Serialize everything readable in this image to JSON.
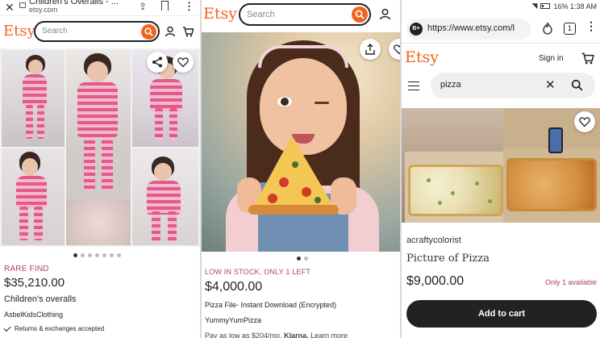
{
  "panel1": {
    "tab_title": "Children's Overalls - ...",
    "tab_url": "etsy.com",
    "logo": "Etsy",
    "search_placeholder": "Search",
    "badge": "RARE FIND",
    "price": "$35,210.00",
    "title": "Children's overalls",
    "shop": "AsbelKidsClothing",
    "returns": "Returns & exchanges accepted",
    "image_dots": 7,
    "active_dot": 1,
    "icons": [
      "close-icon",
      "lock-icon",
      "share-icon",
      "bookmark-icon",
      "more-icon",
      "search-icon",
      "user-icon",
      "cart-icon",
      "heart-icon"
    ]
  },
  "panel2": {
    "logo": "Etsy",
    "search_placeholder": "Search",
    "badge": "LOW IN STOCK, ONLY 1 LEFT",
    "price": "$4,000.00",
    "title": "Pizza File- Instant Download (Encrypted)",
    "shop": "YummyYumPizza",
    "pay_prefix": "Pay as low as $204/mo.",
    "pay_brand": "Klarna.",
    "pay_link": "Learn more",
    "image_dots": 2,
    "active_dot": 1
  },
  "panel3": {
    "status": "16%  1:38 AM",
    "url": "https://www.etsy.com/l",
    "tab_count": "1",
    "logo": "Etsy",
    "sign_in": "Sign in",
    "search_value": "pizza",
    "shop": "acraftycolorist",
    "title": "Picture of Pizza",
    "price": "$9,000.00",
    "availability": "Only 1 available",
    "add_to_cart": "Add to cart"
  },
  "colors": {
    "etsy_orange": "#f1641e",
    "badge_red": "#b0406a",
    "dark": "#222222"
  }
}
